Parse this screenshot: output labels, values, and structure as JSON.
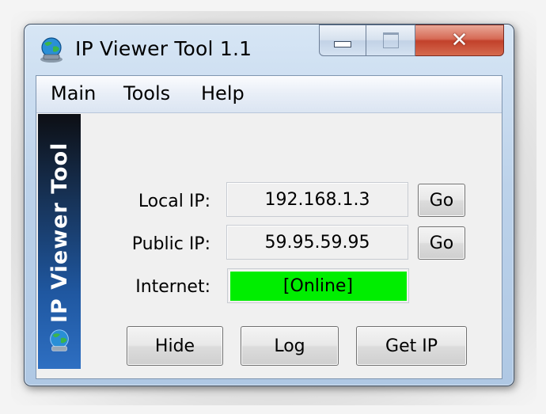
{
  "window": {
    "title": "IP Viewer Tool 1.1",
    "controls": {
      "minimize": "minimize",
      "maximize": "maximize",
      "close": "close"
    }
  },
  "menu": [
    {
      "label": "Main",
      "mnemonic": ""
    },
    {
      "label": "Tools",
      "mnemonic": ""
    },
    {
      "label": "Help",
      "mnemonic": ""
    }
  ],
  "sidebar": {
    "banner_text": "IP Viewer Tool",
    "icon": "globe-network-icon"
  },
  "fields": {
    "local_ip": {
      "label": "Local IP:",
      "value": "192.168.1.3",
      "button": "Go"
    },
    "public_ip": {
      "label": "Public IP:",
      "value": "59.95.59.95",
      "button": "Go"
    },
    "internet": {
      "label": "Internet:",
      "value": "[Online]",
      "status_color": "#00ee00"
    }
  },
  "buttons": {
    "hide": "Hide",
    "log": "Log",
    "get_ip": "Get IP"
  },
  "colors": {
    "online": "#00ee00",
    "close_button": "#c2412b",
    "sidebar_top": "#0d0f14",
    "sidebar_bottom": "#2e6fc2"
  }
}
